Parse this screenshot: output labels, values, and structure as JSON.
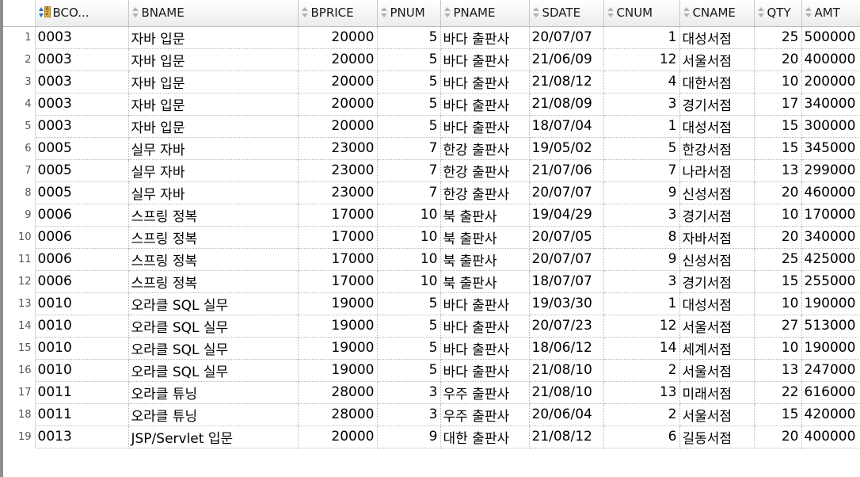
{
  "columns": [
    "BCO...",
    "BNAME",
    "BPRICE",
    "PNUM",
    "PNAME",
    "SDATE",
    "CNUM",
    "CNAME",
    "QTY",
    "AMT"
  ],
  "rows": [
    {
      "n": "1",
      "bco": "0003",
      "bname": "자바 입문",
      "bprice": "20000",
      "pnum": "5",
      "pname": "바다 출판사",
      "sdate": "20/07/07",
      "cnum": "1",
      "cname": "대성서점",
      "qty": "25",
      "amt": "500000"
    },
    {
      "n": "2",
      "bco": "0003",
      "bname": "자바 입문",
      "bprice": "20000",
      "pnum": "5",
      "pname": "바다 출판사",
      "sdate": "21/06/09",
      "cnum": "12",
      "cname": "서울서점",
      "qty": "20",
      "amt": "400000"
    },
    {
      "n": "3",
      "bco": "0003",
      "bname": "자바 입문",
      "bprice": "20000",
      "pnum": "5",
      "pname": "바다 출판사",
      "sdate": "21/08/12",
      "cnum": "4",
      "cname": "대한서점",
      "qty": "10",
      "amt": "200000"
    },
    {
      "n": "4",
      "bco": "0003",
      "bname": "자바 입문",
      "bprice": "20000",
      "pnum": "5",
      "pname": "바다 출판사",
      "sdate": "21/08/09",
      "cnum": "3",
      "cname": "경기서점",
      "qty": "17",
      "amt": "340000"
    },
    {
      "n": "5",
      "bco": "0003",
      "bname": "자바 입문",
      "bprice": "20000",
      "pnum": "5",
      "pname": "바다 출판사",
      "sdate": "18/07/04",
      "cnum": "1",
      "cname": "대성서점",
      "qty": "15",
      "amt": "300000"
    },
    {
      "n": "6",
      "bco": "0005",
      "bname": "실무 자바",
      "bprice": "23000",
      "pnum": "7",
      "pname": "한강 출판사",
      "sdate": "19/05/02",
      "cnum": "5",
      "cname": "한강서점",
      "qty": "15",
      "amt": "345000"
    },
    {
      "n": "7",
      "bco": "0005",
      "bname": "실무 자바",
      "bprice": "23000",
      "pnum": "7",
      "pname": "한강 출판사",
      "sdate": "21/07/06",
      "cnum": "7",
      "cname": "나라서점",
      "qty": "13",
      "amt": "299000"
    },
    {
      "n": "8",
      "bco": "0005",
      "bname": "실무 자바",
      "bprice": "23000",
      "pnum": "7",
      "pname": "한강 출판사",
      "sdate": "20/07/07",
      "cnum": "9",
      "cname": "신성서점",
      "qty": "20",
      "amt": "460000"
    },
    {
      "n": "9",
      "bco": "0006",
      "bname": "스프링 정복",
      "bprice": "17000",
      "pnum": "10",
      "pname": "북 출판사",
      "sdate": "19/04/29",
      "cnum": "3",
      "cname": "경기서점",
      "qty": "10",
      "amt": "170000"
    },
    {
      "n": "10",
      "bco": "0006",
      "bname": "스프링 정복",
      "bprice": "17000",
      "pnum": "10",
      "pname": "북 출판사",
      "sdate": "20/07/05",
      "cnum": "8",
      "cname": "자바서점",
      "qty": "20",
      "amt": "340000"
    },
    {
      "n": "11",
      "bco": "0006",
      "bname": "스프링 정복",
      "bprice": "17000",
      "pnum": "10",
      "pname": "북 출판사",
      "sdate": "20/07/07",
      "cnum": "9",
      "cname": "신성서점",
      "qty": "25",
      "amt": "425000"
    },
    {
      "n": "12",
      "bco": "0006",
      "bname": "스프링 정복",
      "bprice": "17000",
      "pnum": "10",
      "pname": "북 출판사",
      "sdate": "18/07/07",
      "cnum": "3",
      "cname": "경기서점",
      "qty": "15",
      "amt": "255000"
    },
    {
      "n": "13",
      "bco": "0010",
      "bname": "오라클 SQL 실무",
      "bprice": "19000",
      "pnum": "5",
      "pname": "바다 출판사",
      "sdate": "19/03/30",
      "cnum": "1",
      "cname": "대성서점",
      "qty": "10",
      "amt": "190000"
    },
    {
      "n": "14",
      "bco": "0010",
      "bname": "오라클 SQL 실무",
      "bprice": "19000",
      "pnum": "5",
      "pname": "바다 출판사",
      "sdate": "20/07/23",
      "cnum": "12",
      "cname": "서울서점",
      "qty": "27",
      "amt": "513000"
    },
    {
      "n": "15",
      "bco": "0010",
      "bname": "오라클 SQL 실무",
      "bprice": "19000",
      "pnum": "5",
      "pname": "바다 출판사",
      "sdate": "18/06/12",
      "cnum": "14",
      "cname": "세계서점",
      "qty": "10",
      "amt": "190000"
    },
    {
      "n": "16",
      "bco": "0010",
      "bname": "오라클 SQL 실무",
      "bprice": "19000",
      "pnum": "5",
      "pname": "바다 출판사",
      "sdate": "21/08/10",
      "cnum": "2",
      "cname": "서울서점",
      "qty": "13",
      "amt": "247000"
    },
    {
      "n": "17",
      "bco": "0011",
      "bname": "오라클 튜닝",
      "bprice": "28000",
      "pnum": "3",
      "pname": "우주 출판사",
      "sdate": "21/08/10",
      "cnum": "13",
      "cname": "미래서점",
      "qty": "22",
      "amt": "616000"
    },
    {
      "n": "18",
      "bco": "0011",
      "bname": "오라클 튜닝",
      "bprice": "28000",
      "pnum": "3",
      "pname": "우주 출판사",
      "sdate": "20/06/04",
      "cnum": "2",
      "cname": "서울서점",
      "qty": "15",
      "amt": "420000"
    },
    {
      "n": "19",
      "bco": "0013",
      "bname": "JSP/Servlet 입문",
      "bprice": "20000",
      "pnum": "9",
      "pname": "대한 출판사",
      "sdate": "21/08/12",
      "cnum": "6",
      "cname": "길동서점",
      "qty": "20",
      "amt": "400000"
    }
  ],
  "colors": {
    "sort_arrow": "#2a6fcf",
    "sort_box": "#e3b341",
    "gridline": "#b9b9b9"
  },
  "icons": {
    "active_sort": "sort-ascending-icon",
    "column_sort": "sort-updown-icon"
  }
}
